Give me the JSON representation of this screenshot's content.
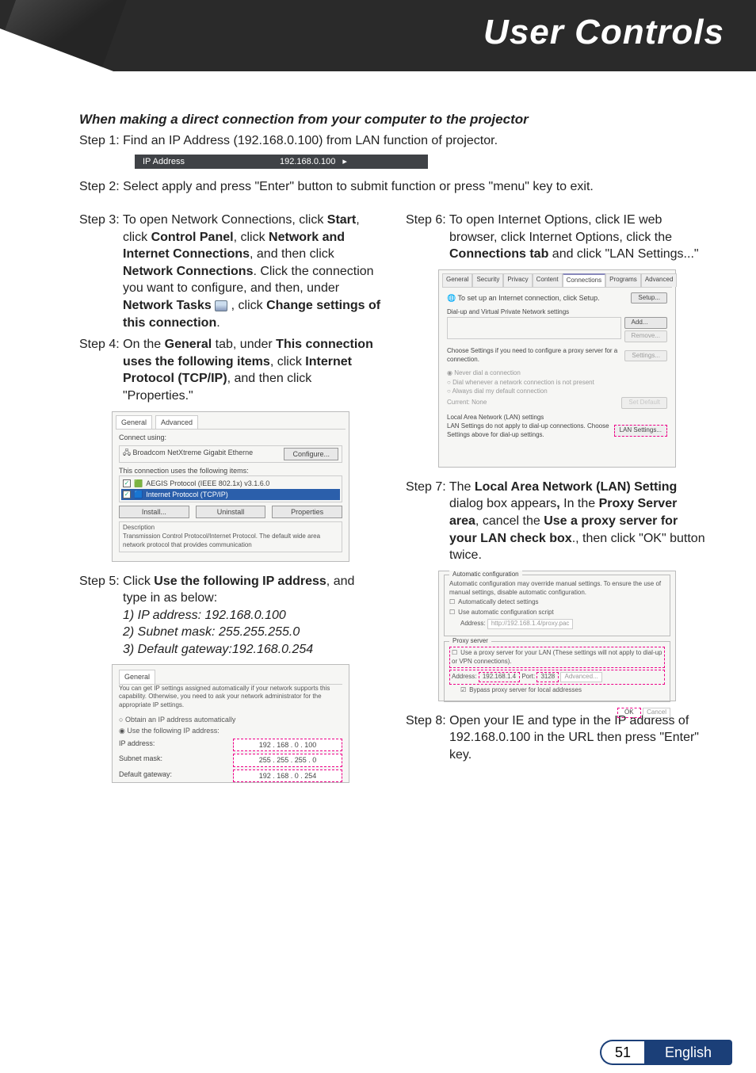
{
  "header": {
    "title": "User Controls"
  },
  "intro": {
    "heading": "When making a direct connection from your computer to the projector",
    "step1": "Step 1: Find an IP Address (192.168.0.100) from LAN function of projector.",
    "ip_label": "IP Address",
    "ip_value": "192.168.0.100",
    "step2": "Step 2: Select apply and press \"Enter\" button to submit function or press \"menu\" key to exit."
  },
  "left": {
    "step3_a": "Step 3: To open Network Connections, click ",
    "start": "Start",
    "s3_b": ", click ",
    "cp": "Control Panel",
    "s3_c": ", click ",
    "nic": "Network and Internet Connections",
    "s3_d": ", and then click ",
    "nc": "Network Connections",
    "s3_e": ". Click the connection you want to configure, and then, under ",
    "nt": "Network Tasks",
    "s3_f": " , click ",
    "chg": "Change settings of this connection",
    "s3_g": ".",
    "step4_a": "Step 4: On the ",
    "gen": "General",
    "s4_b": " tab, under ",
    "tcu": "This connection uses the following items",
    "s4_c": ", click ",
    "ip": "Internet Protocol (TCP/IP)",
    "s4_d": ", and then click \"Properties.\"",
    "step5_a": "Step 5: Click ",
    "ufip": "Use the following IP address",
    "s5_b": ", and type in as below:",
    "s5_1": "1) IP address: 192.168.0.100",
    "s5_2": "2) Subnet mask: 255.255.255.0",
    "s5_3": "3) Default gateway:192.168.0.254"
  },
  "right": {
    "step6_a": "Step 6: To open Internet Options, click IE web browser, click Internet Options, click the ",
    "ctab": "Connections tab",
    "s6_b": " and click \"LAN Settings...\"",
    "step7_a": "Step 7: The ",
    "lan": "Local Area Network (LAN) Setting",
    "s7_b": " dialog box appears",
    "s7_c": " In the ",
    "psa": "Proxy Server area",
    "s7_d": ", cancel the ",
    "upc": "Use a proxy server for your LAN check box",
    "s7_e": "., then click \"OK\" button twice.",
    "step8": "Step 8: Open your IE and type in the IP address of 192.168.0.100 in the URL then press \"Enter\" key."
  },
  "shot_np": {
    "tab_general": "General",
    "tab_adv": "Advanced",
    "connect_label": "Connect using:",
    "adapter": "Broadcom NetXtreme Gigabit Etherne",
    "cfg": "Configure...",
    "uses": "This connection uses the following items:",
    "item1": "AEGIS Protocol (IEEE 802.1x) v3.1.6.0",
    "item2": "Internet Protocol (TCP/IP)",
    "install": "Install...",
    "uninstall": "Uninstall",
    "props": "Properties",
    "desc_label": "Description",
    "desc": "Transmission Control Protocol/Internet Protocol. The default wide area network protocol that provides communication"
  },
  "shot_ip": {
    "tab": "General",
    "txt": "You can get IP settings assigned automatically if your network supports this capability. Otherwise, you need to ask your network administrator for the appropriate IP settings.",
    "r1": "Obtain an IP address automatically",
    "r2": "Use the following IP address:",
    "ipaddr_l": "IP address:",
    "ipaddr_v": "192 . 168 .  0  . 100",
    "mask_l": "Subnet mask:",
    "mask_v": "255 . 255 . 255 .  0",
    "gw_l": "Default gateway:",
    "gw_v": "192 . 168 .  0  . 254"
  },
  "shot_io": {
    "tabs": [
      "General",
      "Security",
      "Privacy",
      "Content",
      "Connections",
      "Programs",
      "Advanced"
    ],
    "setup_txt": "To set up an Internet connection, click Setup.",
    "setup": "Setup...",
    "dun": "Dial-up and Virtual Private Network settings",
    "add": "Add...",
    "remove": "Remove...",
    "choose": "Choose Settings if you need to configure a proxy server for a connection.",
    "settings": "Settings...",
    "r1": "Never dial a connection",
    "r2": "Dial whenever a network connection is not present",
    "r3": "Always dial my default connection",
    "cur": "Current:",
    "none": "None",
    "setdef": "Set Default",
    "lan_hdr": "Local Area Network (LAN) settings",
    "lan_txt": "LAN Settings do not apply to dial-up connections. Choose Settings above for dial-up settings.",
    "lan_btn": "LAN Settings..."
  },
  "shot_lan": {
    "g1": "Automatic configuration",
    "g1a": "Automatic configuration may override manual settings. To ensure the use of manual settings, disable automatic configuration.",
    "g1b": "Automatically detect settings",
    "g1c": "Use automatic configuration script",
    "g1d_l": "Address:",
    "g1d_v": "http://192.168.1.4/proxy.pac",
    "g2": "Proxy server",
    "g2a": "Use a proxy server for your LAN (These settings will not apply to dial-up or VPN connections).",
    "g2b_l": "Address:",
    "g2b_v": "192.168.1.4",
    "g2c_l": "Port:",
    "g2c_v": "3128",
    "g2c_adv": "Advanced...",
    "g2d": "Bypass proxy server for local addresses",
    "ok": "OK",
    "cancel": "Cancel"
  },
  "footer": {
    "page": "51",
    "lang": "English"
  }
}
